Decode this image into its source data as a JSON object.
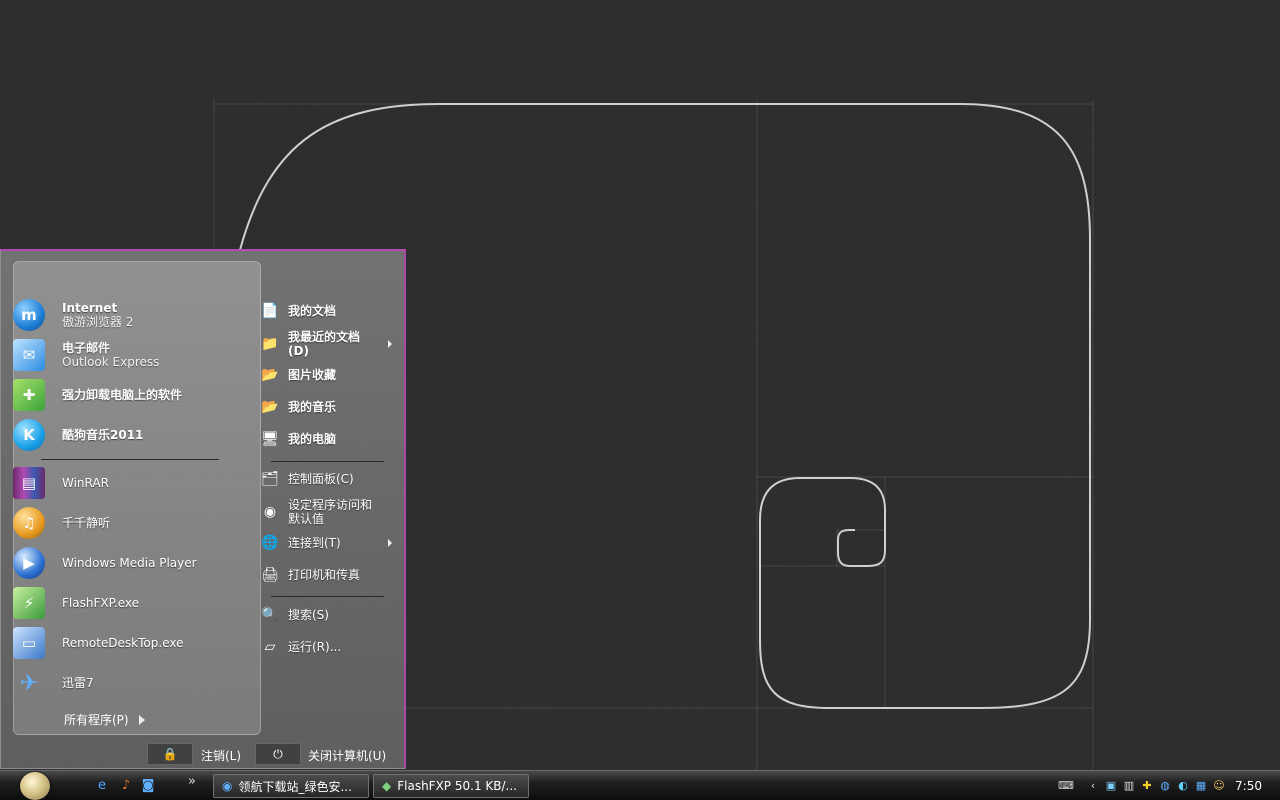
{
  "start_menu": {
    "pinned": [
      {
        "title": "Internet",
        "subtitle": "傲游浏览器 2",
        "icon": "maxthon-browser-icon",
        "color": "#1e7fd6"
      },
      {
        "title": "电子邮件",
        "subtitle": "Outlook Express",
        "icon": "outlook-express-icon",
        "color": "#2c8be0"
      }
    ],
    "recent": [
      {
        "label": "强力卸载电脑上的软件",
        "icon": "uninstaller-icon",
        "color": "#3aa43a",
        "bold": true
      },
      {
        "label": "酷狗音乐2011",
        "icon": "kugou-music-icon",
        "glyph": "K",
        "color": "#1aa0e8",
        "bold": true
      },
      {
        "label": "WinRAR",
        "icon": "winrar-icon",
        "color": "#8a3a8a"
      },
      {
        "label": "千千静听",
        "icon": "ttplayer-icon",
        "color": "#e89a20"
      },
      {
        "label": "Windows Media Player",
        "icon": "windows-media-player-icon",
        "color": "#2a6fd0"
      },
      {
        "label": "FlashFXP.exe",
        "icon": "flashfxp-icon",
        "color": "#3b9a3b"
      },
      {
        "label": "RemoteDeskTop.exe",
        "icon": "remote-desktop-icon",
        "color": "#3a78c8"
      },
      {
        "label": "迅雷7",
        "icon": "thunder-icon",
        "color": "#2d7fd9"
      }
    ],
    "all_programs": "所有程序(P)",
    "places": [
      {
        "label": "我的文档",
        "icon": "my-documents-icon",
        "bold": true
      },
      {
        "label": "我最近的文档(D)",
        "icon": "recent-documents-icon",
        "bold": true,
        "arrow": true
      },
      {
        "label": "图片收藏",
        "icon": "my-pictures-icon",
        "bold": true
      },
      {
        "label": "我的音乐",
        "icon": "my-music-icon",
        "bold": true
      },
      {
        "label": "我的电脑",
        "icon": "my-computer-icon",
        "bold": true
      },
      {
        "label": "控制面板(C)",
        "icon": "control-panel-icon",
        "bold": false
      },
      {
        "label": "设定程序访问和默认值",
        "icon": "program-defaults-icon",
        "bold": false
      },
      {
        "label": "连接到(T)",
        "icon": "connect-to-icon",
        "bold": false,
        "arrow": true
      },
      {
        "label": "打印机和传真",
        "icon": "printers-faxes-icon",
        "bold": false
      },
      {
        "label": "搜索(S)",
        "icon": "search-icon",
        "bold": false
      },
      {
        "label": "运行(R)...",
        "icon": "run-icon",
        "bold": false
      }
    ],
    "logoff_label": "注销(L)",
    "shutdown_label": "关闭计算机(U)"
  },
  "taskbar": {
    "quick_launch": [
      "ie-icon",
      "media-icon",
      "browser-icon"
    ],
    "overflow": "»",
    "tasks": [
      {
        "label": "领航下载站_绿色安...",
        "icon": "maxthon-window-icon"
      },
      {
        "label": "FlashFXP 50.1 KB/...",
        "icon": "flashfxp-window-icon"
      }
    ],
    "tray_icons": [
      "keyboard-icon",
      "expand-tray-icon",
      "network-icon",
      "security-icon",
      "green-plus-icon",
      "shield-icon",
      "update-icon",
      "qq-icon",
      "user-icon"
    ],
    "clock": "7:50"
  }
}
